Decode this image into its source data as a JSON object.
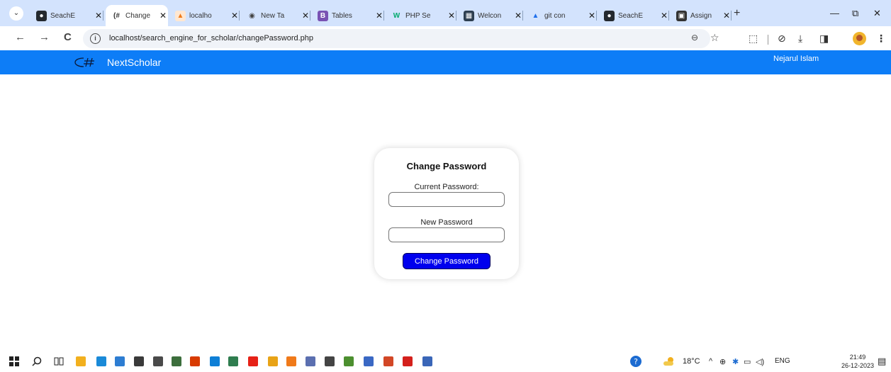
{
  "browser": {
    "tabs": [
      {
        "title": "SeachE",
        "icon": "github-icon",
        "icon_glyph": "●",
        "icon_bg": "#24292f",
        "icon_fg": "#ffffff",
        "close": "✕"
      },
      {
        "title": "Change",
        "icon": "page-icon",
        "icon_glyph": "(#",
        "icon_bg": "#ffffff",
        "icon_fg": "#333333",
        "close": "✕",
        "active": true
      },
      {
        "title": "localho",
        "icon": "xampp-icon",
        "icon_glyph": "▲",
        "icon_bg": "#ffe7d1",
        "icon_fg": "#f07a1a",
        "close": "✕"
      },
      {
        "title": "New Ta",
        "icon": "chrome-icon",
        "icon_glyph": "◉",
        "icon_bg": "#d3e3fd",
        "icon_fg": "#444444",
        "close": "✕"
      },
      {
        "title": "Tables",
        "icon": "bootstrap-icon",
        "icon_glyph": "B",
        "icon_bg": "#7952b3",
        "icon_fg": "#ffffff",
        "close": "✕"
      },
      {
        "title": "PHP Se",
        "icon": "w3schools-icon",
        "icon_glyph": "W",
        "icon_bg": "#d3e3fd",
        "icon_fg": "#04aa6d",
        "close": "✕"
      },
      {
        "title": "Welcon",
        "icon": "site-icon",
        "icon_glyph": "▦",
        "icon_bg": "#2d3e50",
        "icon_fg": "#ffffff",
        "close": "✕"
      },
      {
        "title": "git con",
        "icon": "atlassian-icon",
        "icon_glyph": "▲",
        "icon_bg": "#d3e3fd",
        "icon_fg": "#1f6feb",
        "close": "✕"
      },
      {
        "title": "SeachE",
        "icon": "github-icon",
        "icon_glyph": "●",
        "icon_bg": "#24292f",
        "icon_fg": "#ffffff",
        "close": "✕"
      },
      {
        "title": "Assign",
        "icon": "classroom-icon",
        "icon_glyph": "▣",
        "icon_bg": "#333333",
        "icon_fg": "#ffffff",
        "close": "✕"
      }
    ],
    "tab_menu_glyph": "⌄",
    "new_tab_glyph": "+",
    "window_controls": {
      "minimize": "—",
      "maximize": "⧉",
      "close": "✕"
    },
    "nav": {
      "back": "←",
      "forward": "→",
      "reload": "C"
    },
    "url": "localhost/search_engine_for_scholar/changePassword.php",
    "site_info_glyph": "i",
    "zoom_glyph": "⊖",
    "bookmark_glyph": "☆",
    "toolbar_icons": {
      "extensions": "⬚",
      "history": "⊘",
      "download": "⤓",
      "side_panel": "◨",
      "menu": "⋮"
    }
  },
  "navbar": {
    "brand": "NextScholar",
    "user": "Nejarul Islam",
    "color": "#0d7df7"
  },
  "form": {
    "title": "Change Password",
    "current_label": "Current Password:",
    "new_label": "New Password",
    "current_value": "",
    "new_value": "",
    "submit_label": "Change Password",
    "button_color": "#0000ee"
  },
  "taskbar": {
    "apps": [
      {
        "name": "windows-start-icon",
        "color": "#222222"
      },
      {
        "name": "search-icon",
        "color": "#222222"
      },
      {
        "name": "task-view-icon",
        "color": "#222222"
      },
      {
        "name": "file-explorer-icon",
        "color": "#f2b01e"
      },
      {
        "name": "edge-icon",
        "color": "#1a8ad8"
      },
      {
        "name": "store-icon",
        "color": "#2d7dd2"
      },
      {
        "name": "mail-icon",
        "color": "#3a3a3a"
      },
      {
        "name": "terminal-icon",
        "color": "#4a4a4a"
      },
      {
        "name": "notes-icon",
        "color": "#3c6e3c"
      },
      {
        "name": "office-icon",
        "color": "#d83b01"
      },
      {
        "name": "vscode-icon",
        "color": "#0e7fd6"
      },
      {
        "name": "whiteboard-icon",
        "color": "#2f7d4f"
      },
      {
        "name": "youtube-icon",
        "color": "#e62117"
      },
      {
        "name": "chrome-icon",
        "color": "#e8a317"
      },
      {
        "name": "xampp-icon",
        "color": "#f07a1a"
      },
      {
        "name": "db-icon",
        "color": "#5b6fb0"
      },
      {
        "name": "keyboard-icon",
        "color": "#444444"
      },
      {
        "name": "paint-icon",
        "color": "#4c8f2f"
      },
      {
        "name": "calendar-icon",
        "color": "#3a68c4"
      },
      {
        "name": "powerpoint-icon",
        "color": "#d24726"
      },
      {
        "name": "acrobat-icon",
        "color": "#d4201c"
      },
      {
        "name": "app-icon",
        "color": "#3a66b8"
      }
    ],
    "weather": "18°C",
    "language": "ENG",
    "time": "21:49",
    "date": "26-12-2023",
    "tray_up": "^",
    "tray_network": "⊕",
    "tray_bluetooth": "✱",
    "tray_battery": "▭",
    "tray_volume": "◁)",
    "notification": "▤"
  }
}
